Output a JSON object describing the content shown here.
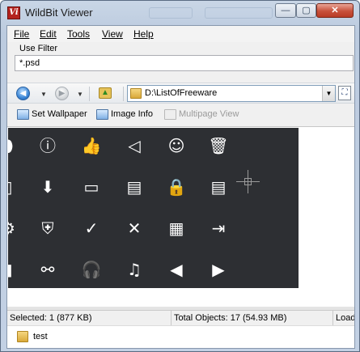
{
  "window": {
    "title": "WildBit Viewer",
    "app_icon_text": "Vi",
    "minimize_symbol": "—",
    "maximize_symbol": "▢",
    "close_symbol": "✕"
  },
  "menu": {
    "items": [
      {
        "label": "File"
      },
      {
        "label": "Edit"
      },
      {
        "label": "Tools"
      },
      {
        "label": "View"
      },
      {
        "label": "Help"
      }
    ]
  },
  "filter": {
    "label": "Use Filter",
    "value": "*.psd"
  },
  "navigation": {
    "path": "D:\\ListOfFreeware",
    "back_icon": "back-arrow-icon",
    "forward_icon": "forward-arrow-icon",
    "up_icon": "folder-up-icon"
  },
  "toolbar": {
    "set_wallpaper": "Set Wallpaper",
    "image_info": "Image Info",
    "multipage_view": "Multipage View"
  },
  "preview": {
    "icon_grid": [
      [
        "pin",
        "info",
        "thumbs-up",
        "speaker",
        "smiley",
        "trash"
      ],
      [
        "contact",
        "download-folder",
        "folder",
        "chat",
        "lock",
        "note"
      ],
      [
        "settings",
        "shield",
        "check",
        "close",
        "grid",
        "export"
      ],
      [
        "battery",
        "link",
        "headphones",
        "music",
        "play-left",
        "play-right"
      ]
    ],
    "glyphs": [
      [
        "⬮",
        "ⓘ",
        "👍",
        "◁",
        "☺",
        "🗑"
      ],
      [
        "▯",
        "⬇",
        "▭",
        "▤",
        "🔒",
        "▤"
      ],
      [
        "⚙",
        "⛨",
        "✓",
        "✕",
        "▦",
        "⇥"
      ],
      [
        "▮",
        "⚯",
        "🎧",
        "♫",
        "◀",
        "▶"
      ]
    ]
  },
  "status": {
    "selected": "Selected: 1 (877 KB)",
    "total": "Total Objects: 17 (54.93 MB)",
    "loading": "Load"
  },
  "folders": [
    {
      "name": "test"
    }
  ],
  "colors": {
    "preview_background": "#2d2f33",
    "icon_color": "#ffffff",
    "title_accent": "#b4231e"
  }
}
